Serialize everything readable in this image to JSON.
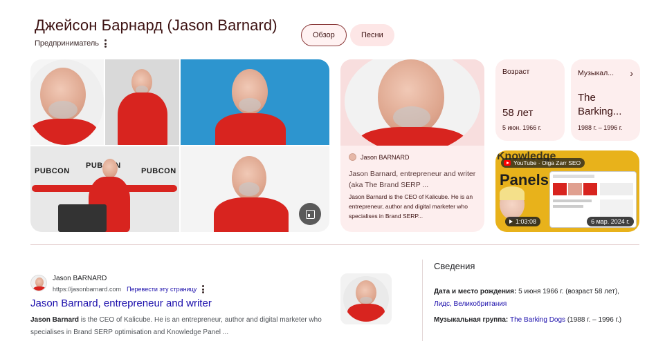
{
  "header": {
    "title": "Джейсон Барнард (Jason Barnard)",
    "subtitle": "Предприниматель",
    "tabs": [
      {
        "label": "Обзор",
        "active": true
      },
      {
        "label": "Песни",
        "active": false
      }
    ]
  },
  "image_grid": {
    "pubcon_label": "PUBCON"
  },
  "featured_card": {
    "source": "Jason BARNARD",
    "title": "Jason Barnard, entrepreneur and writer (aka The Brand SERP ...",
    "description": "Jason Barnard is the CEO of Kalicube. He is an entrepreneur, author and digital marketer who specialises in Brand SERP..."
  },
  "facts": {
    "age": {
      "label": "Возраст",
      "value": "58 лет",
      "sub": "5 июн. 1966 г."
    },
    "band": {
      "label": "Музыкал...",
      "value": "The Barking...",
      "sub": "1988 г. – 1996 г."
    }
  },
  "video": {
    "badge": "YouTube · Olga Zarr SEO",
    "overlay_title": "Panels",
    "overlay_top": "Knowledge",
    "duration": "1:03:08",
    "date": "6 мар. 2024 г."
  },
  "result": {
    "site_name": "Jason BARNARD",
    "url": "https://jasonbarnard.com",
    "translate": "Перевести эту страницу",
    "title": "Jason Barnard, entrepreneur and writer",
    "snippet_bold": "Jason Barnard",
    "snippet_rest": " is the CEO of Kalicube. He is an entrepreneur, author and digital marketer who specialises in Brand SERP optimisation and Knowledge Panel ..."
  },
  "info": {
    "heading": "Сведения",
    "birth_label": "Дата и место рождения:",
    "birth_value": " 5 июня 1966 г. (возраст 58 лет), ",
    "birth_link": "Лидс, Великобритания",
    "band_label": "Музыкальная группа:",
    "band_link": "The Barking Dogs",
    "band_years": " (1988 г. – 1996 г.)"
  },
  "colors": {
    "accent": "#3c1111",
    "card_bg": "#fdeeee",
    "link": "#1a0dab",
    "shirt": "#d8241f"
  }
}
